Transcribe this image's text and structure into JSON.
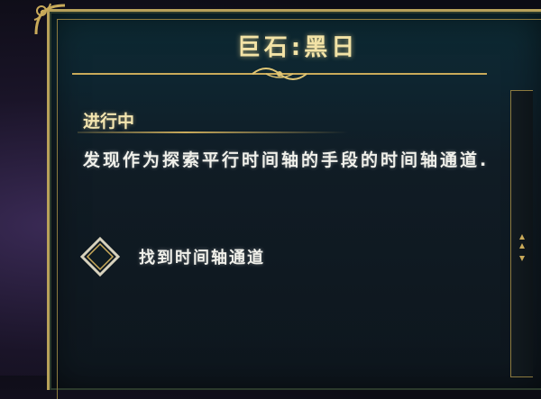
{
  "panel": {
    "title": "巨石:黑日",
    "status": "进行中",
    "description": "发现作为探索平行时间轴的手段的时间轴通道.",
    "objective": {
      "label": "找到时间轴通道",
      "icon": "diamond-objective-icon"
    }
  },
  "colors": {
    "gold": "#c9aa5a",
    "title_text": "#f3e3a6",
    "body_text": "#f0f0ea",
    "panel_bg": "#0e1d26"
  }
}
